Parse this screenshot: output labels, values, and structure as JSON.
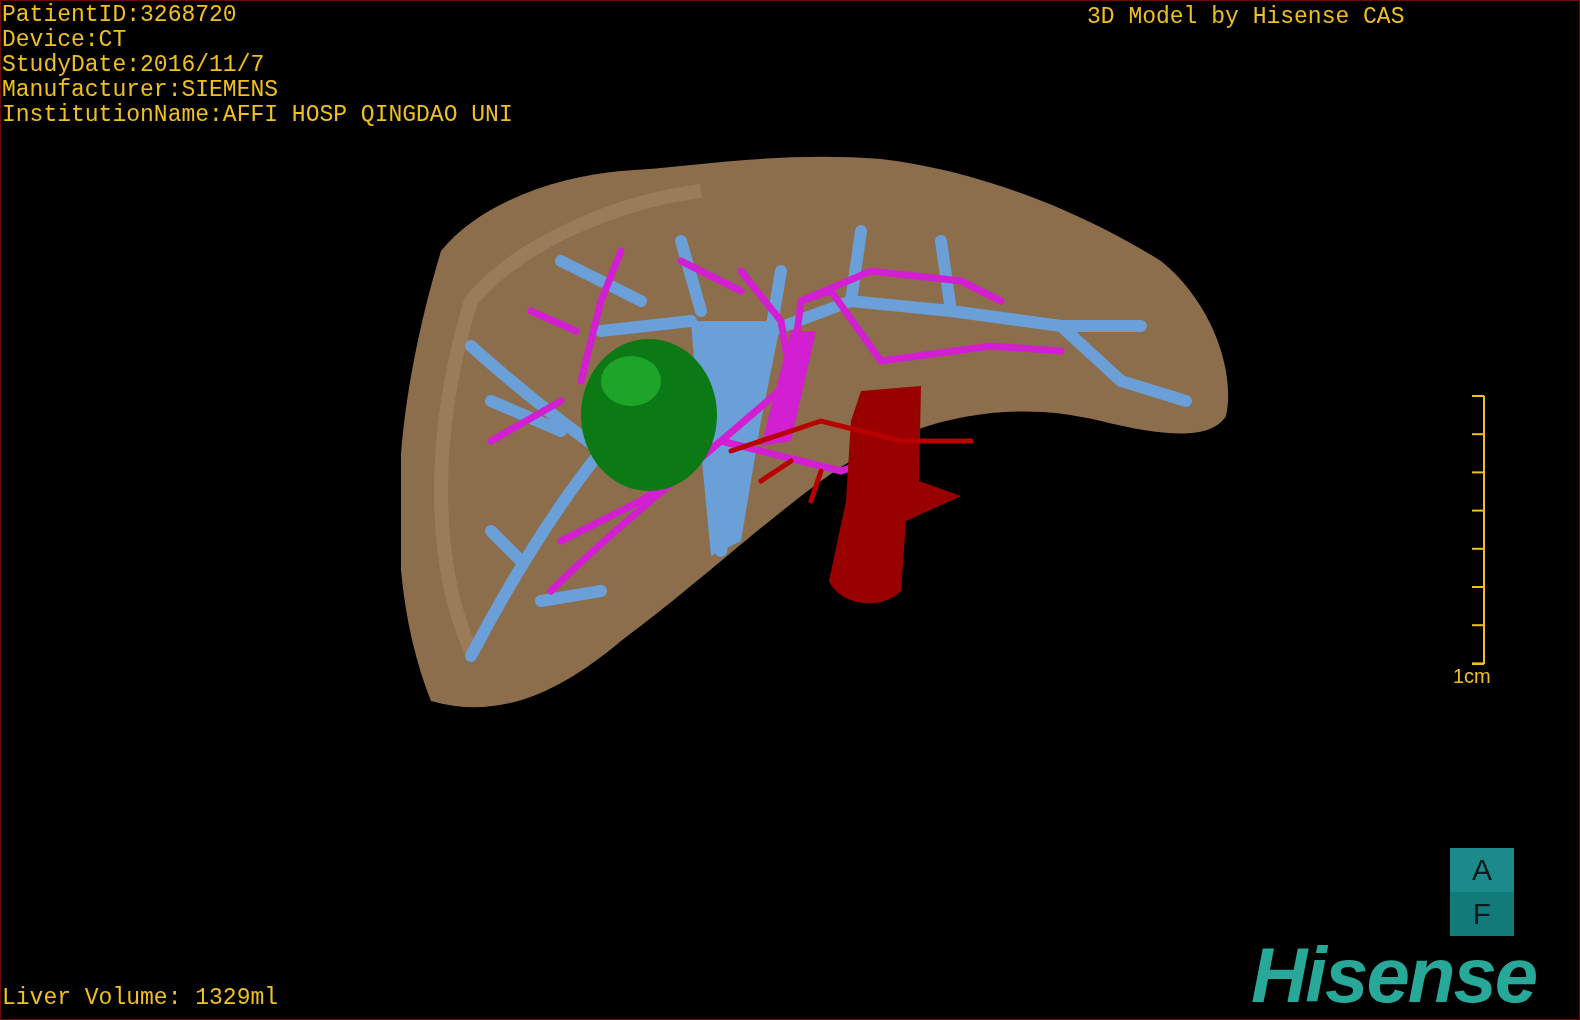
{
  "study_info": [
    "PatientID:3268720",
    "Device:CT",
    "StudyDate:2016/11/7",
    "Manufacturer:SIEMENS",
    "InstitutionName:AFFI HOSP QINGDAO UNI"
  ],
  "model_title": "3D Model by Hisense CAS",
  "scale_bar": {
    "label": "1cm"
  },
  "orientation_cube": {
    "top": "A",
    "bottom": "F"
  },
  "logo": "Hisense",
  "liver_volume": "Liver Volume: 1329ml"
}
